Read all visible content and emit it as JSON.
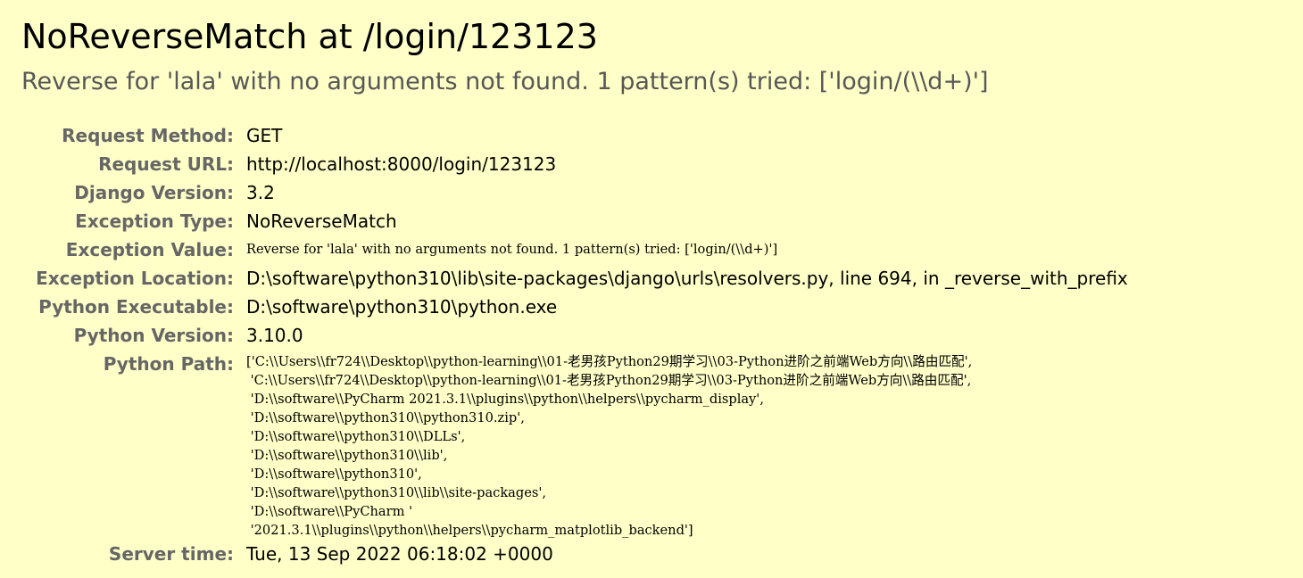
{
  "error": {
    "title": "NoReverseMatch at /login/123123",
    "message": "Reverse for 'lala' with no arguments not found. 1 pattern(s) tried: ['login/(\\\\d+)']"
  },
  "meta": [
    {
      "label": "Request Method:",
      "value": "GET"
    },
    {
      "label": "Request URL:",
      "value": "http://localhost:8000/login/123123"
    },
    {
      "label": "Django Version:",
      "value": "3.2"
    },
    {
      "label": "Exception Type:",
      "value": "NoReverseMatch"
    },
    {
      "label": "Exception Value:",
      "value": "Reverse for 'lala' with no arguments not found. 1 pattern(s) tried: ['login/(\\\\d+)']"
    },
    {
      "label": "Exception Location:",
      "value": "D:\\software\\python310\\lib\\site-packages\\django\\urls\\resolvers.py, line 694, in _reverse_with_prefix"
    },
    {
      "label": "Python Executable:",
      "value": "D:\\software\\python310\\python.exe"
    },
    {
      "label": "Python Version:",
      "value": "3.10.0"
    },
    {
      "label": "Python Path:",
      "value": ""
    },
    {
      "label": "Server time:",
      "value": "Tue, 13 Sep 2022 06:18:02 +0000"
    }
  ],
  "python_path": [
    "['C:\\\\Users\\\\fr724\\\\Desktop\\\\python-learning\\\\01-老男孩Python29期学习\\\\03-Python进阶之前端Web方向\\\\路由匹配',",
    " 'C:\\\\Users\\\\fr724\\\\Desktop\\\\python-learning\\\\01-老男孩Python29期学习\\\\03-Python进阶之前端Web方向\\\\路由匹配',",
    " 'D:\\\\software\\\\PyCharm 2021.3.1\\\\plugins\\\\python\\\\helpers\\\\pycharm_display',",
    " 'D:\\\\software\\\\python310\\\\python310.zip',",
    " 'D:\\\\software\\\\python310\\\\DLLs',",
    " 'D:\\\\software\\\\python310\\\\lib',",
    " 'D:\\\\software\\\\python310',",
    " 'D:\\\\software\\\\python310\\\\lib\\\\site-packages',",
    " 'D:\\\\software\\\\PyCharm '",
    " '2021.3.1\\\\plugins\\\\python\\\\helpers\\\\pycharm_matplotlib_backend']"
  ]
}
